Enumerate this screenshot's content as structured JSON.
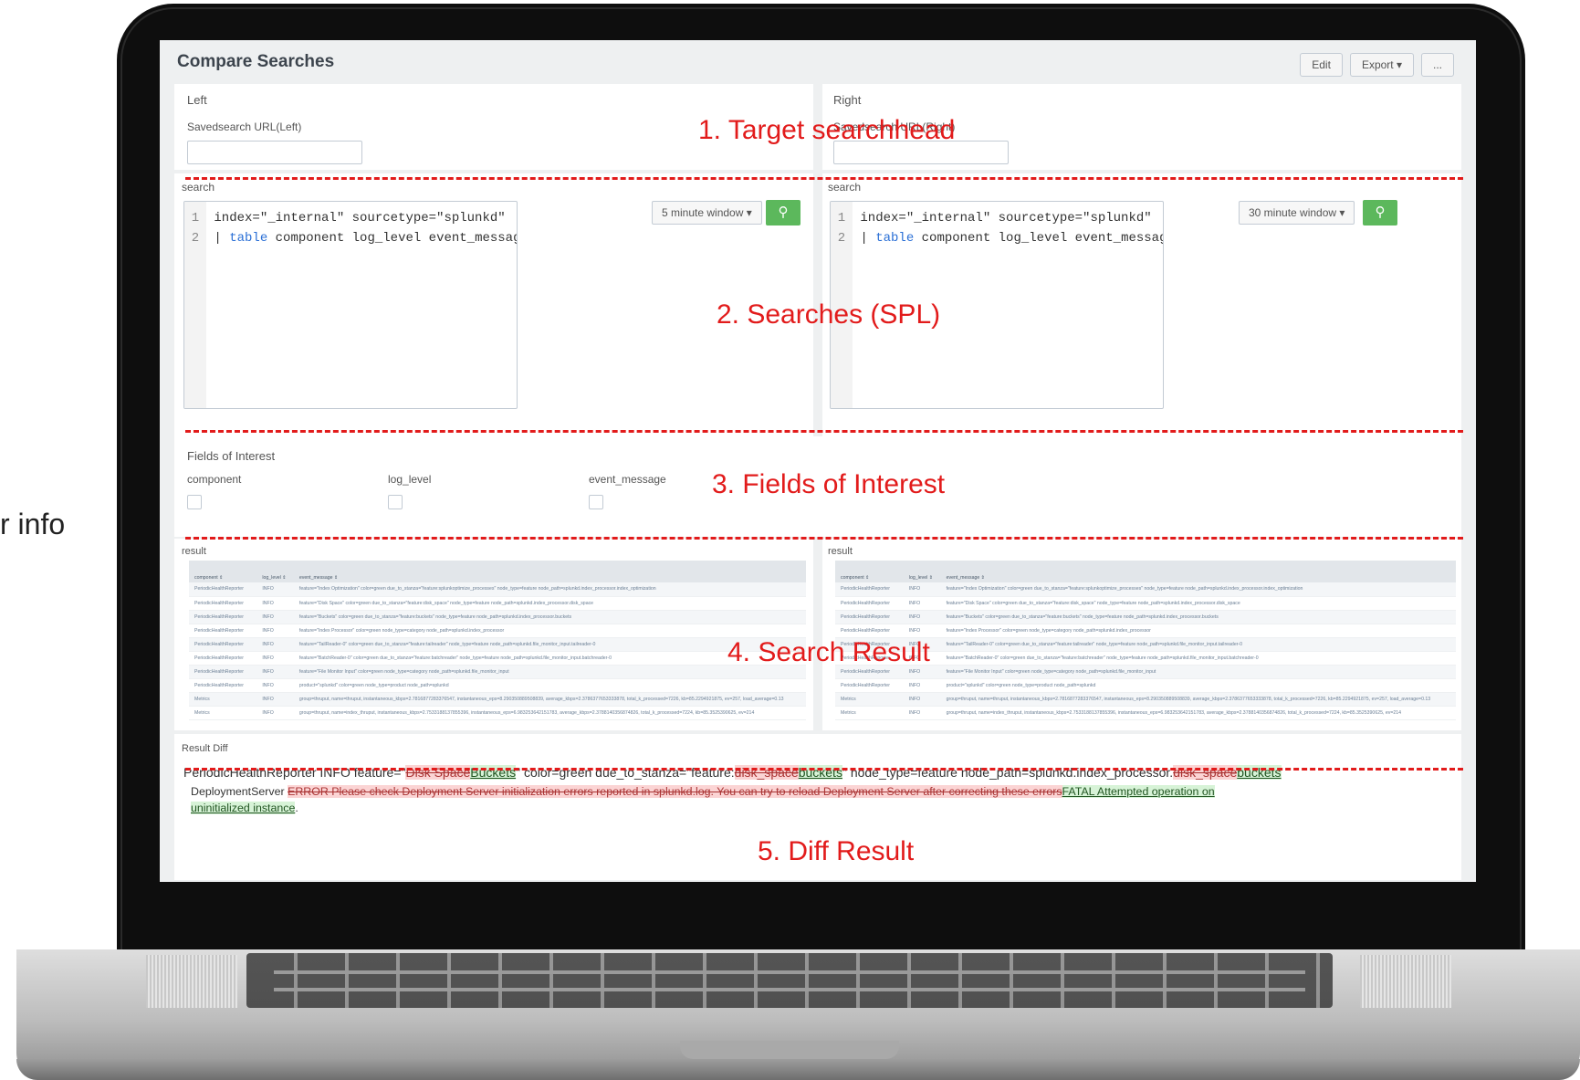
{
  "side_text": "r info",
  "header": {
    "title": "Compare Searches",
    "buttons": {
      "edit": "Edit",
      "export": "Export ▾",
      "more": "..."
    }
  },
  "target": {
    "left_title": "Left",
    "left_label": "Savedsearch URL(Left)",
    "right_title": "Right",
    "right_label": "Savedsearch URL(Right)"
  },
  "search": {
    "label": "search",
    "left": {
      "lines": [
        "index=\"_internal\" sourcetype=\"splunkd\"",
        "table component log_level event_message"
      ],
      "window": "5 minute window ▾"
    },
    "right": {
      "lines": [
        "index=\"_internal\" sourcetype=\"splunkd\"",
        "table component log_level event_message"
      ],
      "window": "30 minute window ▾"
    }
  },
  "fields": {
    "title": "Fields of Interest",
    "items": [
      "component",
      "log_level",
      "event_message"
    ]
  },
  "result": {
    "label": "result",
    "columns": [
      "component ⇕",
      "log_level ⇕",
      "event_message ⇕"
    ],
    "rows": [
      [
        "PeriodicHealthReporter",
        "INFO",
        "feature=\"Index Optimization\" color=green due_to_stanza=\"feature:splunkoptimize_processes\" node_type=feature node_path=splunkd.index_processor.index_optimization"
      ],
      [
        "PeriodicHealthReporter",
        "INFO",
        "feature=\"Disk Space\" color=green due_to_stanza=\"feature:disk_space\" node_type=feature node_path=splunkd.index_processor.disk_space"
      ],
      [
        "PeriodicHealthReporter",
        "INFO",
        "feature=\"Buckets\" color=green due_to_stanza=\"feature:buckets\" node_type=feature node_path=splunkd.index_processor.buckets"
      ],
      [
        "PeriodicHealthReporter",
        "INFO",
        "feature=\"Index Processor\" color=green node_type=category node_path=splunkd.index_processor"
      ],
      [
        "PeriodicHealthReporter",
        "INFO",
        "feature=\"TailReader-0\" color=green due_to_stanza=\"feature:tailreader\" node_type=feature node_path=splunkd.file_monitor_input.tailreader-0"
      ],
      [
        "PeriodicHealthReporter",
        "INFO",
        "feature=\"BatchReader-0\" color=green due_to_stanza=\"feature:batchreader\" node_type=feature node_path=splunkd.file_monitor_input.batchreader-0"
      ],
      [
        "PeriodicHealthReporter",
        "INFO",
        "feature=\"File Monitor Input\" color=green node_type=category node_path=splunkd.file_monitor_input"
      ],
      [
        "PeriodicHealthReporter",
        "INFO",
        "product=\"splunkd\" color=green node_type=product node_path=splunkd"
      ],
      [
        "Metrics",
        "INFO",
        "group=thruput, name=thruput, instantaneous_kbps=2.7816877283376547, instantaneous_eps=8.290350889508839, average_kbps=2.3786377653333878, total_k_processed=7226, kb=85.2294921875, ev=257, load_average=0.13"
      ],
      [
        "Metrics",
        "INFO",
        "group=thruput, name=index_thruput, instantaneous_kbps=2.7533188137855396, instantaneous_eps=6.983253642151783, average_kbps=2.3788140356874826, total_k_processed=7224, kb=85.3525390625, ev=214"
      ]
    ]
  },
  "diff": {
    "title": "Result Diff",
    "line1": {
      "p1": "PeriodicHealthReporter INFO feature=\"",
      "del1": "Disk Space",
      "ins1": "Buckets",
      "p2": "\" color=green due_to_stanza=\"feature:",
      "del2": "disk_space",
      "ins2": "buckets",
      "p3": "\" node_type=feature node_path=splunkd.index_processor.",
      "del3": "disk_space",
      "ins3": "buckets"
    },
    "line2": {
      "p1": "DeploymentServer ",
      "del1": "ERROR Please check Deployment Server initialization errors reported in splunkd.log. You can try to reload Deployment Server after correcting these errors",
      "ins1": "FATAL Attempted operation on"
    },
    "line3": {
      "ins1": "uninitialized instance",
      "p1": "."
    }
  },
  "annotations": [
    "1. Target searchhead",
    "2. Searches (SPL)",
    "3. Fields of Interest",
    "4. Search Result",
    "5. Diff Result"
  ],
  "colors": {
    "annotation": "#e21b1b",
    "search_button": "#5cb85c"
  }
}
